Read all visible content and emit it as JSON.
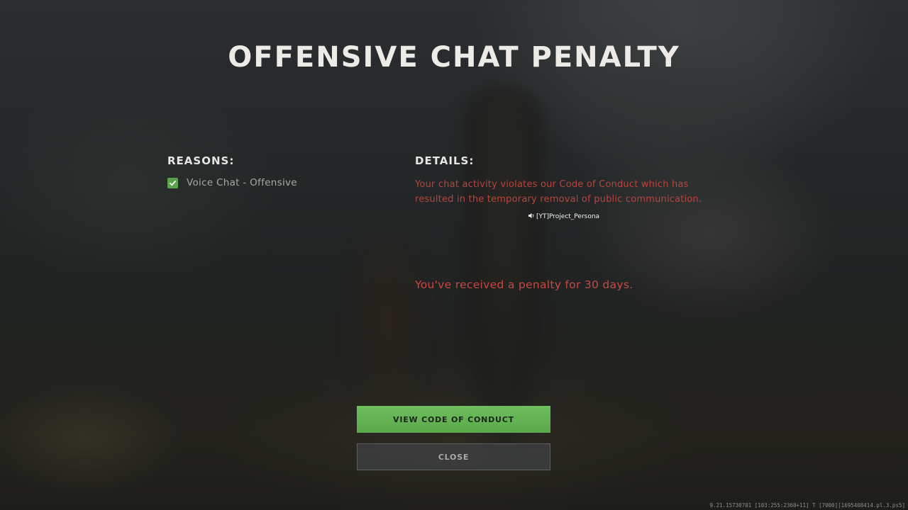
{
  "title": "OFFENSIVE CHAT PENALTY",
  "reasons": {
    "heading": "REASONS:",
    "items": [
      {
        "label": "Voice Chat - Offensive",
        "checked": true
      }
    ]
  },
  "details": {
    "heading": "DETAILS:",
    "text": "Your chat activity violates our Code of Conduct which has resulted in the temporary removal of public communication.",
    "penalty": "You've received a penalty for 30 days."
  },
  "voice_indicator": {
    "icon": "speaker-icon",
    "username": "[YT]Project_Persona"
  },
  "buttons": {
    "view_code_label": "VIEW CODE OF CONDUCT",
    "close_label": "CLOSE"
  },
  "build_info": "9.21.15730701 [103:255:2360+11] T [7000][1695408414.pl.3.ps5]",
  "colors": {
    "accent_green": "#5aa84b",
    "penalty_red": "#c24a43",
    "title_text": "#ecebe6"
  }
}
